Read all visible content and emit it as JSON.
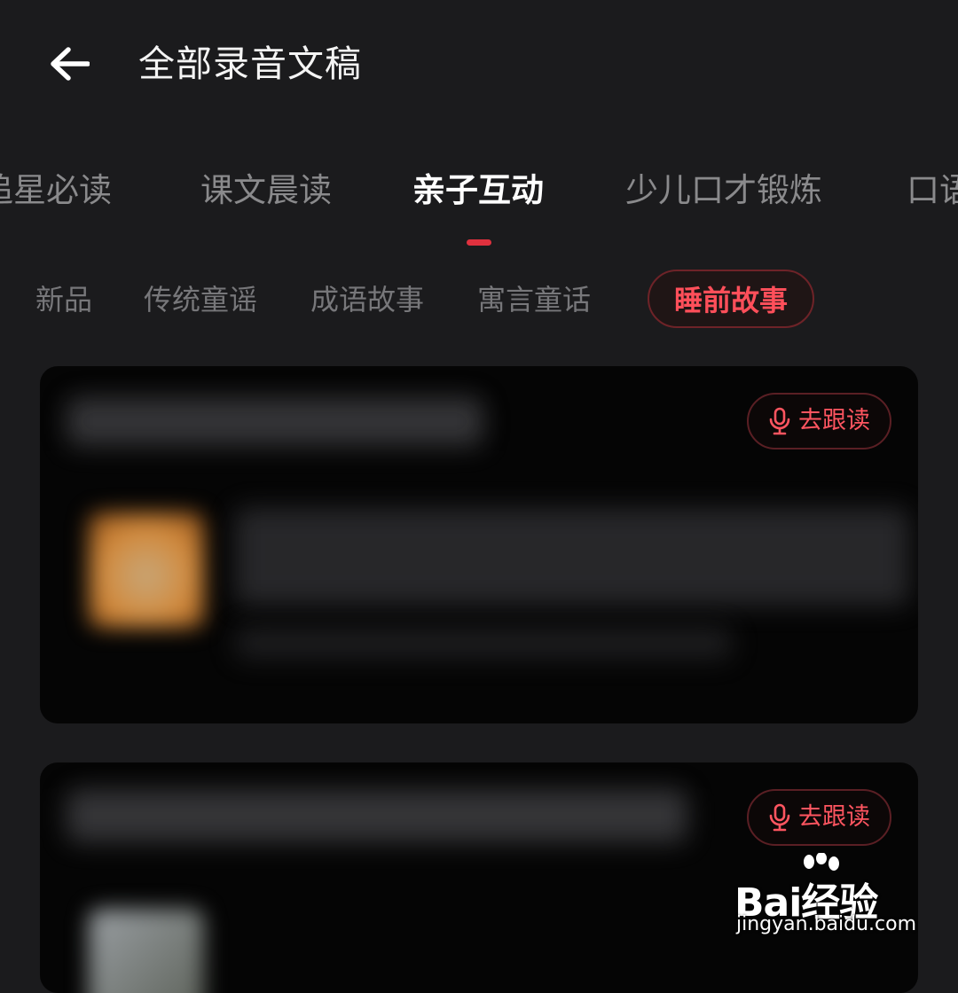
{
  "header": {
    "title": "全部录音文稿"
  },
  "tabs": [
    {
      "label": "追星必读"
    },
    {
      "label": "课文晨读"
    },
    {
      "label": "亲子互动"
    },
    {
      "label": "少儿口才锻炼"
    },
    {
      "label": "口语"
    }
  ],
  "active_tab": "亲子互动",
  "subtabs": [
    {
      "label": "新品"
    },
    {
      "label": "传统童谣"
    },
    {
      "label": "成语故事"
    },
    {
      "label": "寓言童话"
    },
    {
      "label": "睡前故事"
    }
  ],
  "active_subtab": "睡前故事",
  "cards": [
    {
      "follow_label": "去跟读"
    },
    {
      "follow_label": "去跟读"
    }
  ],
  "watermark": {
    "logo": "Bai经验",
    "url": "jingyan.baidu.com"
  },
  "colors": {
    "accent": "#e0313e",
    "background": "#1b1b1d",
    "card": "#050505"
  }
}
